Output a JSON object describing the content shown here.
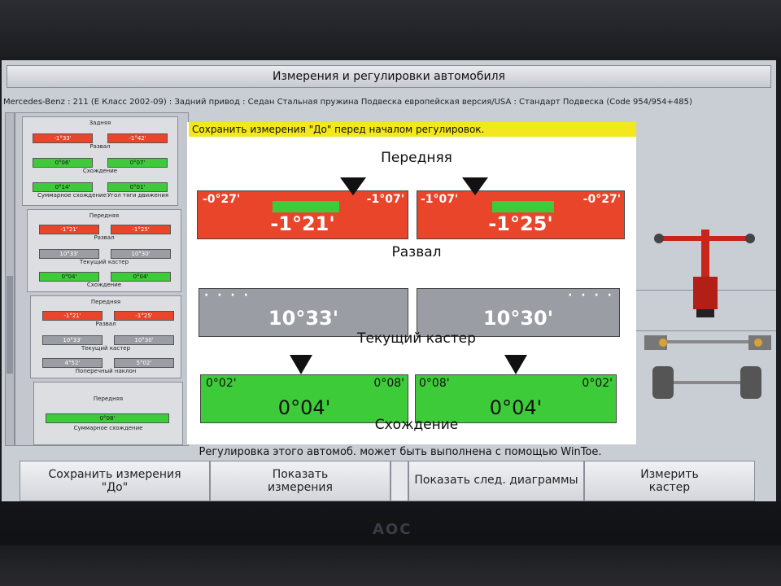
{
  "window": {
    "title": "Измерения и регулировки автомобиля",
    "subtitle": "Mercedes-Benz : 211 (E Класс 2002-09) : Задний привод : Седан Стальная пружина Подвеска европейская версия/USA : Стандарт Подвеска (Code 954/954+485)"
  },
  "banner": "Сохранить измерения \"До\" перед началом регулировок.",
  "sections": {
    "front_title": "Передняя",
    "camber_label": "Развал",
    "caster_label": "Текущий кастер",
    "toe_label": "Схождение"
  },
  "camber": {
    "left": {
      "corner_left": "-0°27'",
      "corner_right": "-1°07'",
      "value": "-1°21'"
    },
    "right": {
      "corner_left": "-1°07'",
      "corner_right": "-0°27'",
      "value": "-1°25'"
    }
  },
  "caster": {
    "left": {
      "value": "10°33'"
    },
    "right": {
      "value": "10°30'"
    }
  },
  "toe": {
    "left": {
      "corner_left": "0°02'",
      "corner_right": "0°08'",
      "value": "0°04'"
    },
    "right": {
      "corner_left": "0°08'",
      "corner_right": "0°02'",
      "value": "0°04'"
    }
  },
  "sidebar": {
    "card1": {
      "title": "Задняя",
      "camber_left": "-1°33'",
      "camber_right": "-1°42'",
      "camber_label": "Развал",
      "toe_left": "0°06'",
      "toe_right": "0°07'",
      "toe_label": "Схождение",
      "total_toe": "0°14'",
      "thrust": "0°01'",
      "total_label": "Суммарное схождение",
      "thrust_label": "Угол тяги движения"
    },
    "card2": {
      "title": "Передняя",
      "camber_left": "-1°21'",
      "camber_right": "-1°25'",
      "camber_label": "Развал",
      "caster_left": "10°33'",
      "caster_right": "10°30'",
      "caster_label": "Текущий кастер",
      "toe_left": "0°04'",
      "toe_right": "0°04'",
      "toe_label": "Схождение"
    },
    "card3": {
      "title": "Передняя",
      "camber_left": "-1°21'",
      "camber_right": "-1°25'",
      "camber_label": "Развал",
      "caster_left": "10°33'",
      "caster_right": "10°30'",
      "caster_label": "Текущий кастер",
      "sai_left": "4°52'",
      "sai_right": "5°02'",
      "sai_label": "Поперечный наклон"
    },
    "card4": {
      "title": "Передняя",
      "total_toe": "0°08'",
      "total_label": "Суммарное схождение"
    }
  },
  "status": "Регулировка этого автомоб. может быть выполнена с помощью WinToe.",
  "buttons": {
    "save_line1": "Сохранить  измерения",
    "save_line2": "\"До\"",
    "show_line1": "Показать",
    "show_line2": "измерения",
    "next_diagrams": "Показать след. диаграммы",
    "caster_line1": "Измерить",
    "caster_line2": "кастер"
  },
  "monitor_brand": "AOC",
  "colors": {
    "out_of_spec": "#e8452a",
    "in_spec": "#3ecb3a",
    "neutral": "#9a9da3",
    "banner": "#f2e81d"
  }
}
